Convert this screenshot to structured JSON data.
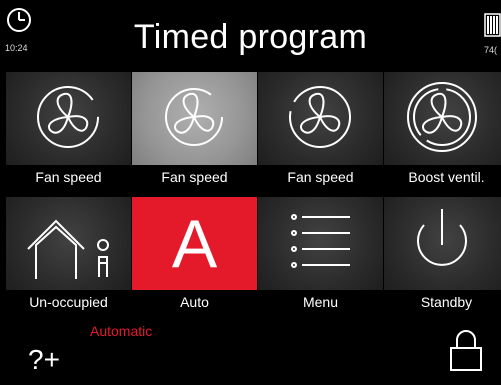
{
  "header": {
    "time": "10:24",
    "title": "Timed program",
    "battery_text": "74("
  },
  "tiles": [
    {
      "label": "Fan speed",
      "icon": "fan-icon",
      "selected": false
    },
    {
      "label": "Fan speed",
      "icon": "fan-icon",
      "selected": true
    },
    {
      "label": "Fan speed",
      "icon": "fan-icon",
      "selected": false
    },
    {
      "label": "Boost ventil.",
      "icon": "fan-boost-icon",
      "selected": false
    },
    {
      "label": "Un-occupied",
      "icon": "house-person-icon",
      "selected": false
    },
    {
      "label": "Auto",
      "icon": "auto-icon",
      "selected": true,
      "letter": "A"
    },
    {
      "label": "Menu",
      "icon": "menu-list-icon",
      "selected": false
    },
    {
      "label": "Standby",
      "icon": "power-icon",
      "selected": false
    }
  ],
  "footer": {
    "status": "Automatic",
    "help_symbol": "?+"
  },
  "colors": {
    "accent": "#e41a2b",
    "selected_gray": "#969696",
    "tile_dark": "#2b2b2b"
  }
}
